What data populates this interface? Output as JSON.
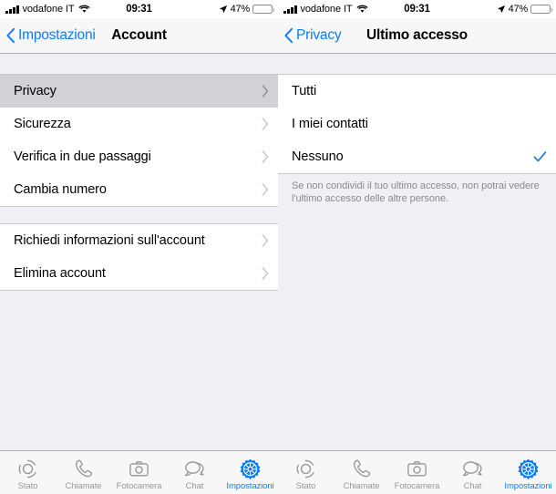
{
  "status_bar": {
    "carrier": "vodafone IT",
    "time": "09:31",
    "battery_pct": "47%",
    "battery_level": 47,
    "signal_icon": "signal-bars-icon",
    "wifi_icon": "wifi-icon",
    "location_icon": "location-arrow-icon",
    "battery_icon": "battery-icon"
  },
  "colors": {
    "accent": "#0a7cff",
    "selected_row": "#d1d1d6",
    "background": "#efeff4",
    "separator": "#c8c7cc",
    "footnote_text": "#8a8a8f",
    "inactive_tab": "#979797"
  },
  "left_screen": {
    "nav": {
      "back_label": "Impostazioni",
      "back_icon": "chevron-left-icon",
      "title": "Account"
    },
    "groups": [
      {
        "rows": [
          {
            "label": "Privacy",
            "selected": true,
            "accessory": "chevron-right-icon"
          },
          {
            "label": "Sicurezza",
            "selected": false,
            "accessory": "chevron-right-icon"
          },
          {
            "label": "Verifica in due passaggi",
            "selected": false,
            "accessory": "chevron-right-icon"
          },
          {
            "label": "Cambia numero",
            "selected": false,
            "accessory": "chevron-right-icon"
          }
        ]
      },
      {
        "rows": [
          {
            "label": "Richiedi informazioni sull'account",
            "selected": false,
            "accessory": "chevron-right-icon"
          },
          {
            "label": "Elimina account",
            "selected": false,
            "accessory": "chevron-right-icon"
          }
        ]
      }
    ]
  },
  "right_screen": {
    "nav": {
      "back_label": "Privacy",
      "back_icon": "chevron-left-icon",
      "title": "Ultimo accesso"
    },
    "options": [
      {
        "label": "Tutti",
        "checked": false
      },
      {
        "label": "I miei contatti",
        "checked": false
      },
      {
        "label": "Nessuno",
        "checked": true,
        "accessory": "checkmark-icon"
      }
    ],
    "footnote": "Se non condividi il tuo ultimo accesso, non potrai vedere l'ultimo accesso delle altre persone."
  },
  "tab_bar": {
    "items": [
      {
        "label": "Stato",
        "icon": "status-rings-icon",
        "active": false
      },
      {
        "label": "Chiamate",
        "icon": "phone-icon",
        "active": false
      },
      {
        "label": "Fotocamera",
        "icon": "camera-icon",
        "active": false
      },
      {
        "label": "Chat",
        "icon": "chat-bubbles-icon",
        "active": false
      },
      {
        "label": "Impostazioni",
        "icon": "gear-icon",
        "active": true
      }
    ]
  }
}
